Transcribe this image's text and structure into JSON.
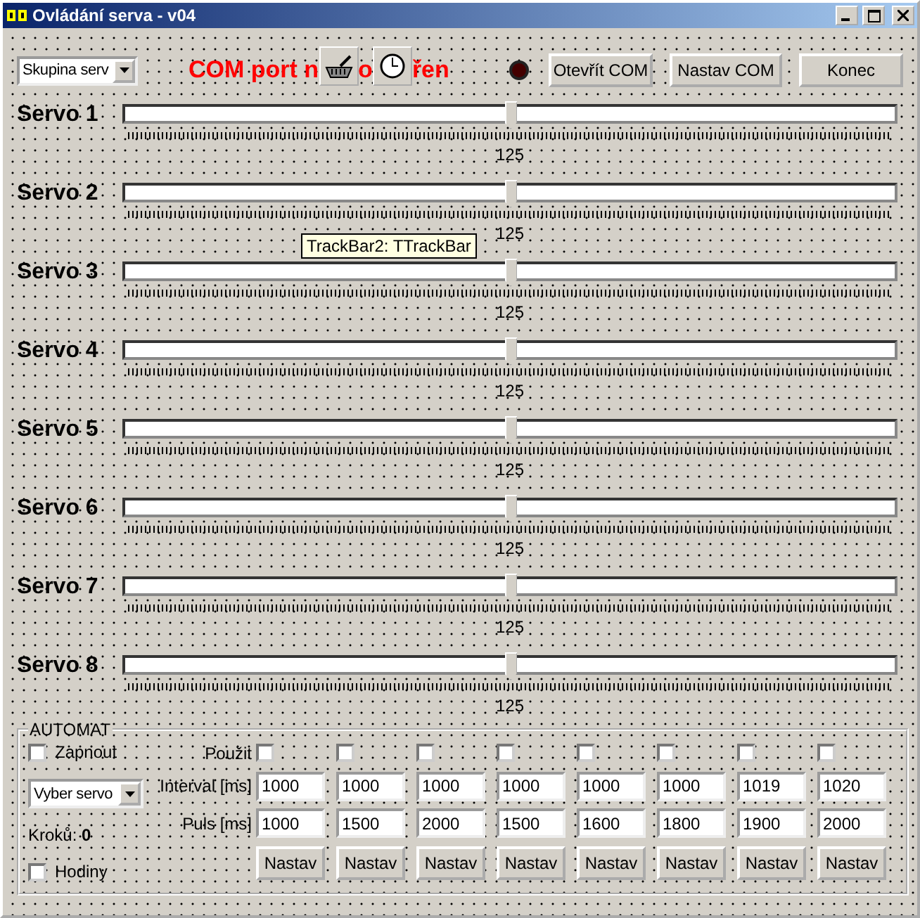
{
  "window": {
    "title": "Ovládání serva - v04"
  },
  "toolbar": {
    "group_select": "Skupina serv",
    "status_parts": [
      "COM port n",
      "o",
      "řen"
    ],
    "led_on": false,
    "buttons": [
      "Otevřít COM",
      "Nastav COM",
      "Konec"
    ]
  },
  "servos": [
    {
      "name": "Servo 1",
      "level": 0.5,
      "value": "125"
    },
    {
      "name": "Servo 2",
      "level": 0.5,
      "value": "125"
    },
    {
      "name": "Servo 3",
      "level": 0.5,
      "value": "125"
    },
    {
      "name": "Servo 4",
      "level": 0.5,
      "value": "125"
    },
    {
      "name": "Servo 5",
      "level": 0.5,
      "value": "125"
    },
    {
      "name": "Servo 6",
      "level": 0.5,
      "value": "125"
    },
    {
      "name": "Servo 7",
      "level": 0.5,
      "value": "125"
    },
    {
      "name": "Servo 8",
      "level": 0.5,
      "value": "125"
    }
  ],
  "tooltip": "TrackBar2: TTrackBar",
  "automat": {
    "title": "AUTOMAT",
    "enable": {
      "label": "Zapnout",
      "checked": false
    },
    "servo_select": "Vyber servo",
    "steps": "Kroků: **0**",
    "clock": {
      "label": "Hodiny",
      "checked": false
    },
    "use_label": "Použit",
    "interval_label": "Interval [ms]",
    "pulse_label": "Puls [ms]",
    "columns": [
      {
        "use": false,
        "interval": "1000",
        "pulse": "1000",
        "button": "Nastav"
      },
      {
        "use": false,
        "interval": "1000",
        "pulse": "1500",
        "button": "Nastav"
      },
      {
        "use": false,
        "interval": "1000",
        "pulse": "2000",
        "button": "Nastav"
      },
      {
        "use": false,
        "interval": "1000",
        "pulse": "1500",
        "button": "Nastav"
      },
      {
        "use": false,
        "interval": "1000",
        "pulse": "1600",
        "button": "Nastav"
      },
      {
        "use": false,
        "interval": "1000",
        "pulse": "1800",
        "button": "Nastav"
      },
      {
        "use": false,
        "interval": "1019",
        "pulse": "1900",
        "button": "Nastav"
      },
      {
        "use": false,
        "interval": "1020",
        "pulse": "2000",
        "button": "Nastav"
      }
    ]
  }
}
